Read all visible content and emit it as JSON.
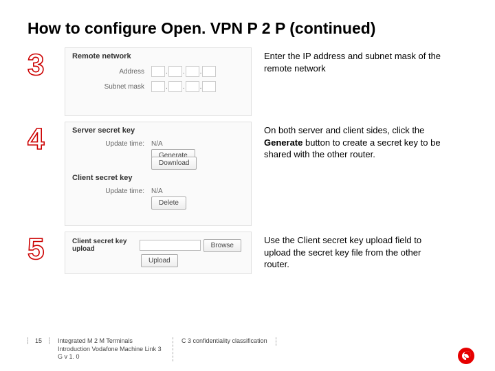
{
  "title": "How to configure Open. VPN P 2 P (continued)",
  "steps": {
    "s3": {
      "num": "3",
      "panel_title": "Remote network",
      "row1_label": "Address",
      "row2_label": "Subnet mask",
      "desc": "Enter the IP address and subnet mask of the remote network"
    },
    "s4": {
      "num": "4",
      "server_title": "Server secret key",
      "client_title": "Client secret key",
      "update_label": "Update time:",
      "update_val": "N/A",
      "btn_generate": "Generate",
      "btn_download": "Download",
      "btn_delete": "Delete",
      "desc_pre": "On both server and client sides, click the ",
      "desc_bold": "Generate",
      "desc_post": " button to create a secret key to be shared with the other router."
    },
    "s5": {
      "num": "5",
      "upload_title": "Client secret key upload",
      "btn_browse": "Browse",
      "btn_upload": "Upload",
      "desc": "Use the Client secret key upload field to upload the secret key file from the other router."
    }
  },
  "footer": {
    "page": "15",
    "line1": "Integrated M 2 M Terminals",
    "line2": "Introduction Vodafone Machine Link 3 G v 1. 0",
    "class": "C 3 confidentiality classification"
  }
}
